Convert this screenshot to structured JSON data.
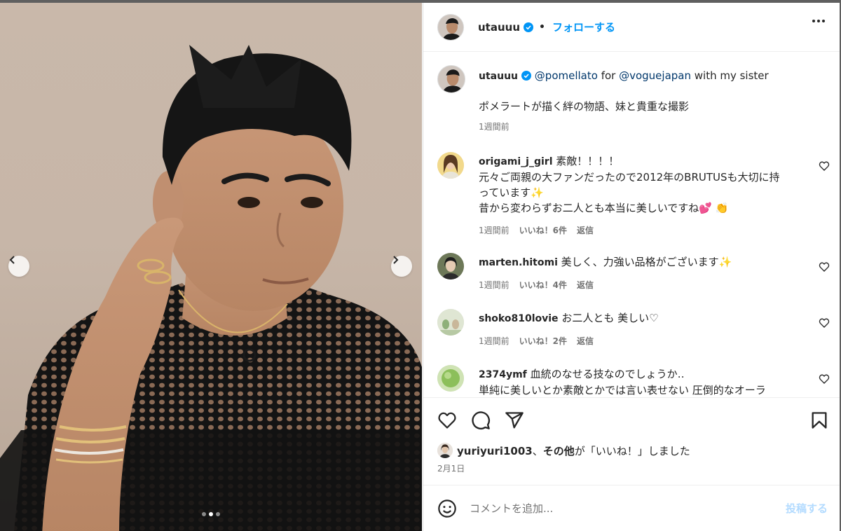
{
  "post": {
    "author": "utauuu",
    "follow_label": "フォローする",
    "separator": "•",
    "caption": {
      "mention1": "@pomellato",
      "for_text": " for ",
      "mention2": "@voguejapan",
      "rest": " with my sister",
      "line2": "ポメラートが描く絆の物語、妹と貴重な撮影",
      "time": "1週間前"
    },
    "comments": [
      {
        "user": "origami_j_girl",
        "text_l1": "素敵！！！！",
        "text_l2": "元々ご両親の大ファンだったので2012年のBRUTUSも大切に持",
        "text_l3": "っています✨",
        "text_l4": "昔から変わらずお二人とも本当に美しいですね💕 👏",
        "time": "1週間前",
        "likes": "いいね！6件",
        "reply": "返信"
      },
      {
        "user": "marten.hitomi",
        "text_l1": "美しく、力強い品格がございます✨",
        "time": "1週間前",
        "likes": "いいね！4件",
        "reply": "返信"
      },
      {
        "user": "shoko810lovie",
        "text_l1": "お二人とも 美しい♡",
        "time": "1週間前",
        "likes": "いいね！2件",
        "reply": "返信"
      },
      {
        "user": "2374ymf",
        "text_l1": "血統のなせる技なのでしょうか‥",
        "text_l2": "単純に美しいとか素敵とかでは言い表せない 圧倒的なオーラ"
      }
    ],
    "liked_by": {
      "user": "yuriyuri1003",
      "joiner": "、",
      "others": "その他",
      "suffix": "が「いいね！」しました"
    },
    "date": "2月1日",
    "comment_placeholder": "コメントを追加...",
    "post_label": "投稿する",
    "carousel": {
      "count": 3,
      "active_index": 1
    }
  },
  "colors": {
    "accent": "#0095f6",
    "text": "#262626",
    "secondary": "#737373",
    "mention": "#00376b",
    "post_disabled": "#b3dbff"
  },
  "icons": [
    "verified-badge-icon",
    "more-options-icon",
    "heart-icon",
    "comment-icon",
    "share-icon",
    "bookmark-icon",
    "emoji-icon",
    "chevron-left-icon",
    "chevron-right-icon"
  ]
}
